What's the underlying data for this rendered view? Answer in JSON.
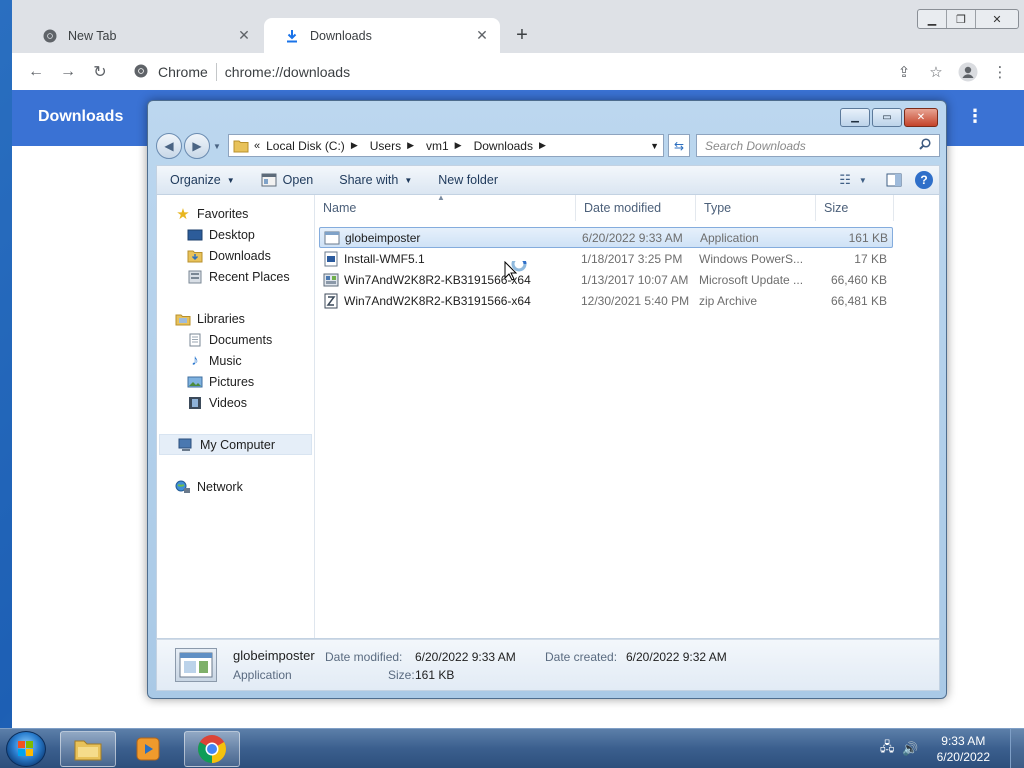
{
  "chrome": {
    "tabs": [
      {
        "title": "New Tab",
        "icon": "chrome-icon",
        "active": false
      },
      {
        "title": "Downloads",
        "icon": "download-icon",
        "active": true
      }
    ],
    "omnibox": {
      "label": "Chrome",
      "url": "chrome://downloads"
    },
    "page": {
      "title": "Downloads"
    }
  },
  "explorer": {
    "breadcrumb": [
      "Local Disk (C:)",
      "Users",
      "vm1",
      "Downloads"
    ],
    "search_placeholder": "Search Downloads",
    "commands": {
      "organize": "Organize",
      "open": "Open",
      "share_with": "Share with",
      "new_folder": "New folder"
    },
    "nav": {
      "favorites": {
        "label": "Favorites",
        "items": [
          "Desktop",
          "Downloads",
          "Recent Places"
        ]
      },
      "libraries": {
        "label": "Libraries",
        "items": [
          "Documents",
          "Music",
          "Pictures",
          "Videos"
        ]
      },
      "computer": "My Computer",
      "network": "Network"
    },
    "columns": {
      "name": "Name",
      "date": "Date modified",
      "type": "Type",
      "size": "Size"
    },
    "files": [
      {
        "name": "globeimposter",
        "date": "6/20/2022 9:33 AM",
        "type": "Application",
        "size": "161 KB",
        "icon": "application-icon",
        "selected": true
      },
      {
        "name": "Install-WMF5.1",
        "date": "1/18/2017 3:25 PM",
        "type": "Windows PowerS...",
        "size": "17 KB",
        "icon": "powershell-script-icon",
        "selected": false
      },
      {
        "name": "Win7AndW2K8R2-KB3191566-x64",
        "date": "1/13/2017 10:07 AM",
        "type": "Microsoft Update ...",
        "size": "66,460 KB",
        "icon": "update-package-icon",
        "selected": false
      },
      {
        "name": "Win7AndW2K8R2-KB3191566-x64",
        "date": "12/30/2021 5:40 PM",
        "type": "zip Archive",
        "size": "66,481 KB",
        "icon": "zip-archive-icon",
        "selected": false
      }
    ],
    "details": {
      "name": "globeimposter",
      "type": "Application",
      "modified_label": "Date modified:",
      "modified_value": "6/20/2022 9:33 AM",
      "created_label": "Date created:",
      "created_value": "6/20/2022 9:32 AM",
      "size_label": "Size:",
      "size_value": "161 KB"
    }
  },
  "taskbar": {
    "time": "9:33 AM",
    "date": "6/20/2022"
  }
}
